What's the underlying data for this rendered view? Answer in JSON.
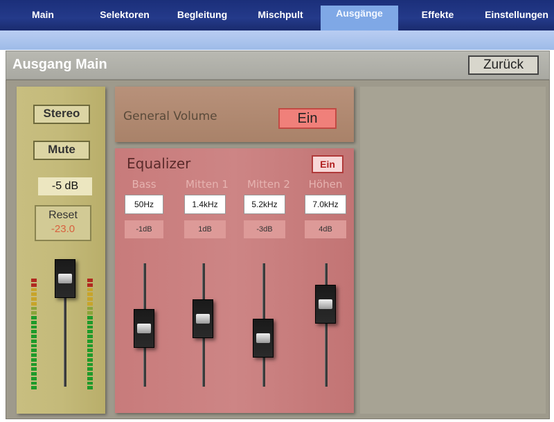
{
  "tabs": [
    {
      "label": "Main"
    },
    {
      "label": "Selektoren"
    },
    {
      "label": "Begleitung"
    },
    {
      "label": "Mischpult"
    },
    {
      "label": "Ausgänge",
      "active": true
    },
    {
      "label": "Effekte"
    },
    {
      "label": "Einstellungen"
    }
  ],
  "header": {
    "title": "Ausgang Main",
    "back_label": "Zurück"
  },
  "main_channel": {
    "stereo_label": "Stereo",
    "mute_label": "Mute",
    "level": "-5 dB",
    "reset_label": "Reset",
    "reset_value": "-23.0"
  },
  "general_volume": {
    "label": "General Volume",
    "toggle_label": "Ein"
  },
  "equalizer": {
    "title": "Equalizer",
    "toggle_label": "Ein",
    "bands": [
      {
        "name": "Bass",
        "frequency": "50Hz",
        "gain": "-1dB"
      },
      {
        "name": "Mitten 1",
        "frequency": "1.4kHz",
        "gain": "1dB"
      },
      {
        "name": "Mitten 2",
        "frequency": "5.2kHz",
        "gain": "-3dB"
      },
      {
        "name": "Höhen",
        "frequency": "7.0kHz",
        "gain": "4dB"
      }
    ]
  },
  "colors": {
    "tabbar": "#1b2f7a",
    "active_tab": "#7fa8e6",
    "left_panel": "#c4ba7a",
    "general_panel": "#a98269",
    "eq_panel": "#cd8585",
    "toggle_on": "#f0807a"
  },
  "icons": {
    "fader_knob": "fader-knob-icon",
    "level_meter": "level-meter-icon"
  }
}
